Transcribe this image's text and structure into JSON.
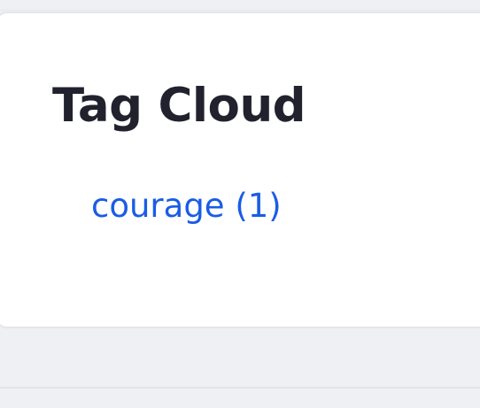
{
  "widget": {
    "title": "Tag Cloud",
    "tags": [
      {
        "label": "courage (1)",
        "name": "courage",
        "count": 1
      }
    ]
  },
  "colors": {
    "page_background": "#eff0f4",
    "card_background": "#ffffff",
    "title_text": "#22222e",
    "link": "#1a5ce6"
  }
}
